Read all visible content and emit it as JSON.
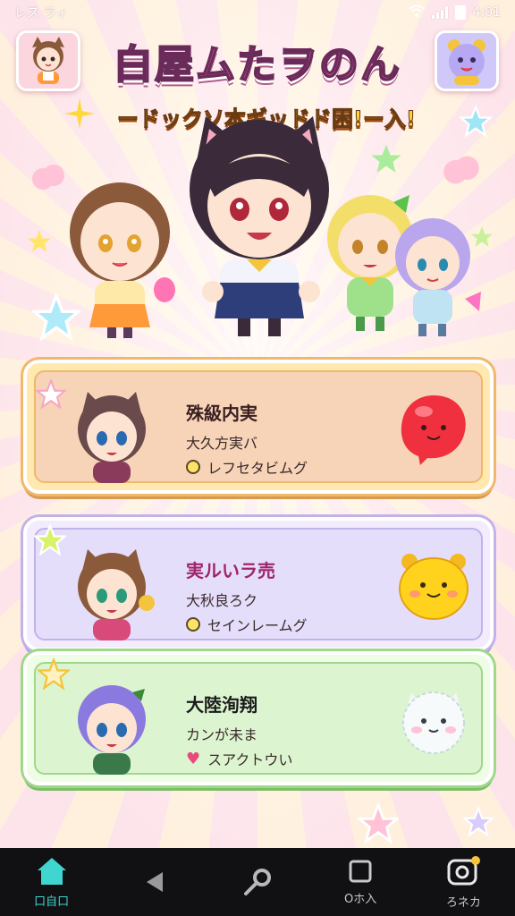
{
  "status_bar": {
    "left_text": "レス ラィ",
    "time": "4:01"
  },
  "header": {
    "title": "白屋ムたヲのん",
    "subtitle": "ードックソ本ギッドド困!ー入!"
  },
  "quests": [
    {
      "title": "殊級内実",
      "subtitle": "大久方実バ",
      "status": "レフセタビムグ",
      "status_icon": "clock-icon"
    },
    {
      "title": "実ルいラ売",
      "subtitle": "大秋良ろク",
      "status": "セインレームグ",
      "status_icon": "clock-icon"
    },
    {
      "title": "大陸洵翔",
      "subtitle": "カンが未ま",
      "status": "スアクトウい",
      "status_icon": "heart-icon"
    }
  ],
  "nav": [
    {
      "label": "口自口",
      "icon": "home-icon"
    },
    {
      "label": "",
      "icon": "back-icon"
    },
    {
      "label": "",
      "icon": "search-icon"
    },
    {
      "label": "Oホ入",
      "icon": "square-icon"
    },
    {
      "label": "ろネカ",
      "icon": "camera-icon"
    }
  ],
  "colors": {
    "card1": "#f7d3b8",
    "card2": "#e5defb",
    "card3": "#dcf5d0",
    "nav_active": "#3fd6d0",
    "title_pink": "#ff6fa2"
  }
}
